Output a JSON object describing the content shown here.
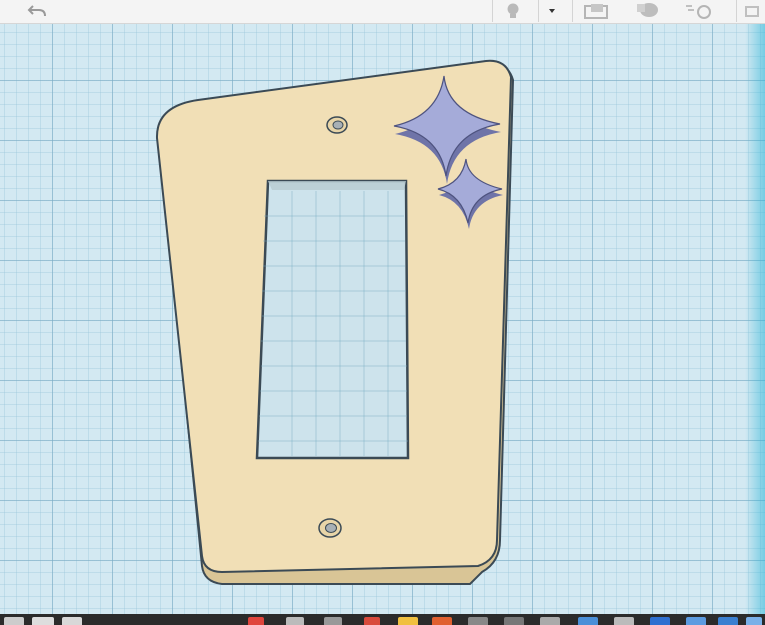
{
  "toolbar": {
    "icons": [
      {
        "name": "undo-arrow-icon",
        "glyph": "↩"
      },
      {
        "name": "light-bulb-icon",
        "glyph": "💡"
      },
      {
        "name": "dropdown-caret-icon",
        "glyph": "▾"
      },
      {
        "name": "notes-icon",
        "glyph": "▣"
      },
      {
        "name": "shape-icon",
        "glyph": "◆"
      },
      {
        "name": "align-icon",
        "glyph": "◎"
      }
    ]
  },
  "workplane": {
    "grid_color": "#7aaac3",
    "background_color": "#d3e9f2"
  },
  "model": {
    "name": "switch-plate-cover",
    "plate_color": "#f1dfb6",
    "plate_edge_color": "#d9c596",
    "sparkle_color": "#a5abd9",
    "sparkle_shadow_color": "#6f74a8",
    "outline_color": "#3b4a55"
  },
  "taskbar": {
    "icon_colors": [
      "#cccccc",
      "#dddddd",
      "#e0453d",
      "#f0c040",
      "#d94a3c",
      "#888888",
      "#e06030",
      "#4a8fd8",
      "#2e6fd0",
      "#5c9be0",
      "#3a7fd0",
      "#7ab0e8"
    ]
  }
}
